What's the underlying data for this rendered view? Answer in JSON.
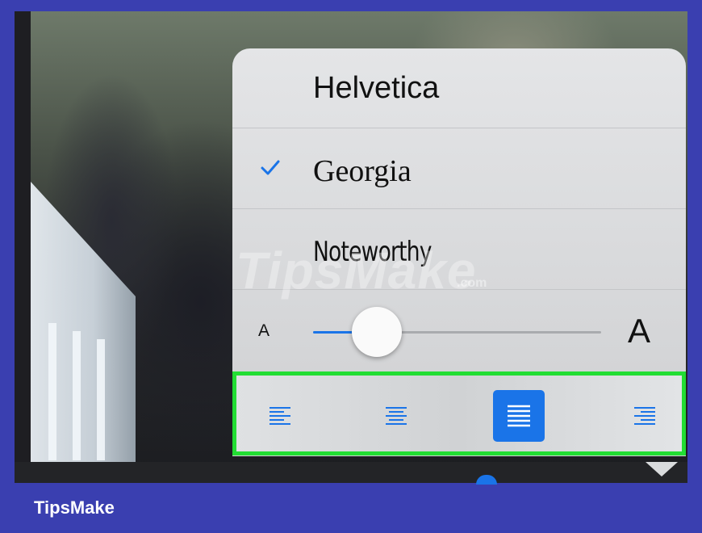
{
  "fonts": {
    "items": [
      {
        "label": "Helvetica",
        "selected": false
      },
      {
        "label": "Georgia",
        "selected": true
      },
      {
        "label": "Noteworthy",
        "selected": false
      }
    ]
  },
  "text_size": {
    "small_label": "A",
    "large_label": "A",
    "value": 0.22
  },
  "alignment": {
    "options": [
      {
        "name": "align-left",
        "selected": false
      },
      {
        "name": "align-center",
        "selected": false
      },
      {
        "name": "justify",
        "selected": true
      },
      {
        "name": "align-right",
        "selected": false
      }
    ],
    "highlight_color": "#22dd33"
  },
  "watermark": {
    "text": "TipsMake",
    "suffix": ".com"
  },
  "brand": {
    "label": "TipsMake"
  },
  "colors": {
    "accent": "#1a74e8",
    "frame": "#3a3fb0",
    "highlight": "#22dd33"
  },
  "icons": {
    "check": "checkmark-icon",
    "align": [
      "align-left-icon",
      "align-center-icon",
      "justify-icon",
      "align-right-icon"
    ]
  }
}
